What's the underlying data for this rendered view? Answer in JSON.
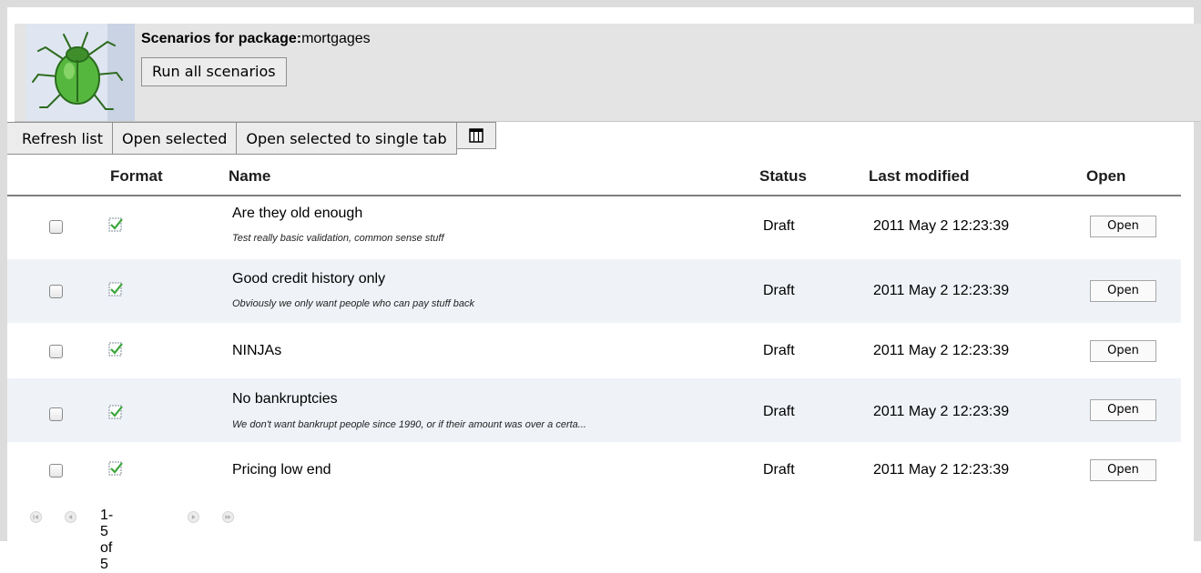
{
  "header": {
    "title_bold": "Scenarios for package:",
    "package_name": "mortgages",
    "run_all_label": "Run all scenarios"
  },
  "toolbar": {
    "refresh_label": "Refresh list",
    "open_selected_label": "Open selected",
    "open_single_tab_label": "Open selected to single tab",
    "columns_icon": "columns-icon"
  },
  "table": {
    "columns": [
      "Format",
      "Name",
      "Status",
      "Last modified",
      "Open"
    ],
    "rows": [
      {
        "name": "Are they old enough",
        "description": "Test really basic validation, common sense stuff",
        "status": "Draft",
        "modified": "2011 May 2 12:23:39",
        "open_label": "Open"
      },
      {
        "name": "Good credit history only",
        "description": "Obviously we only want people who can pay stuff back",
        "status": "Draft",
        "modified": "2011 May 2 12:23:39",
        "open_label": "Open"
      },
      {
        "name": "NINJAs",
        "description": "",
        "status": "Draft",
        "modified": "2011 May 2 12:23:39",
        "open_label": "Open"
      },
      {
        "name": "No bankruptcies",
        "description": "We don't want bankrupt people since 1990, or if their amount was over a certa...",
        "status": "Draft",
        "modified": "2011 May 2 12:23:39",
        "open_label": "Open"
      },
      {
        "name": "Pricing low end",
        "description": "",
        "status": "Draft",
        "modified": "2011 May 2 12:23:39",
        "open_label": "Open"
      }
    ]
  },
  "pager": {
    "range_text": "1-5 of 5"
  },
  "colors": {
    "header_bg": "#e4e4e4",
    "row_alt_bg": "#eff3f8",
    "icon_green": "#3aa63a"
  }
}
